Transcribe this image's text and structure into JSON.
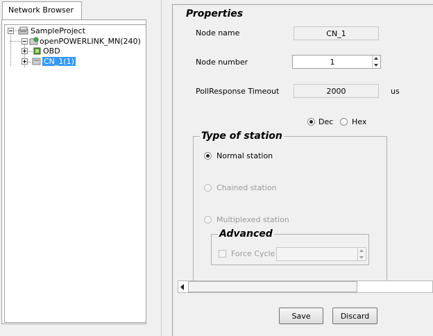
{
  "network_browser": {
    "tab_label": "Network Browser",
    "tree": {
      "root": "SampleProject",
      "mn": "openPOWERLINK_MN(240)",
      "obd": "OBD",
      "cn": "CN_1(1)"
    }
  },
  "properties": {
    "title": "Properties",
    "node_name_label": "Node name",
    "node_name_value": "CN_1",
    "node_number_label": "Node number",
    "node_number_value": "1",
    "poll_timeout_label": "PollResponse Timeout",
    "poll_timeout_value": "2000",
    "poll_timeout_unit": "us",
    "dec_label": "Dec",
    "hex_label": "Hex",
    "type_of_station": {
      "title": "Type of station",
      "normal": "Normal station",
      "chained": "Chained station",
      "multiplexed": "Multiplexed station",
      "advanced": {
        "title": "Advanced",
        "force_cycle": "Force Cycle",
        "force_cycle_value": ""
      }
    },
    "save_label": "Save",
    "discard_label": "Discard"
  }
}
